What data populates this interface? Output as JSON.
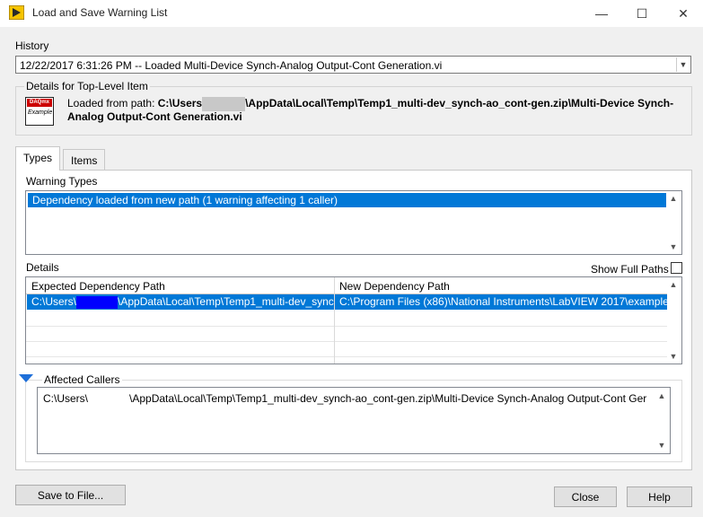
{
  "window": {
    "title": "Load and Save Warning List",
    "controls": {
      "minimize": "—",
      "maximize": "☐",
      "close": "✕"
    }
  },
  "history": {
    "label": "History",
    "selected": "12/22/2017 6:31:26 PM -- Loaded Multi-Device Synch-Analog Output-Cont Generation.vi"
  },
  "details_top": {
    "group_label": "Details for Top-Level Item",
    "icon_top_text": "DAQmx",
    "icon_bottom_text": "Example",
    "loaded_prefix": "Loaded from path: ",
    "path_start": "C:\\Users",
    "path_rest": "\\AppData\\Local\\Temp\\Temp1_multi-dev_synch-ao_cont-gen.zip\\Multi-Device Synch-",
    "path_line2": "Analog Output-Cont Generation.vi"
  },
  "tabs": [
    {
      "label": "Types"
    },
    {
      "label": "Items"
    }
  ],
  "warning_types": {
    "label": "Warning Types",
    "items": [
      "Dependency loaded from new path (1 warning affecting 1 caller)"
    ]
  },
  "details_table": {
    "label": "Details",
    "show_full_paths_label": "Show Full Paths",
    "show_full_paths_checked": false,
    "columns": [
      "Expected Dependency Path",
      "New Dependency Path"
    ],
    "row": {
      "expected_start": "C:\\Users\\",
      "expected_rest": "\\AppData\\Local\\Temp\\Temp1_multi-dev_synch",
      "new_path": "C:\\Program Files (x86)\\National Instruments\\LabVIEW 2017\\examples"
    }
  },
  "affected_callers": {
    "label": "Affected Callers",
    "start": "C:\\Users\\",
    "rest": "\\AppData\\Local\\Temp\\Temp1_multi-dev_synch-ao_cont-gen.zip\\Multi-Device Synch-Analog Output-Cont Ger"
  },
  "buttons": {
    "save": "Save to File...",
    "close": "Close",
    "help": "Help"
  },
  "colors": {
    "selection": "#0078d7",
    "triangle": "#1e6fd9"
  }
}
